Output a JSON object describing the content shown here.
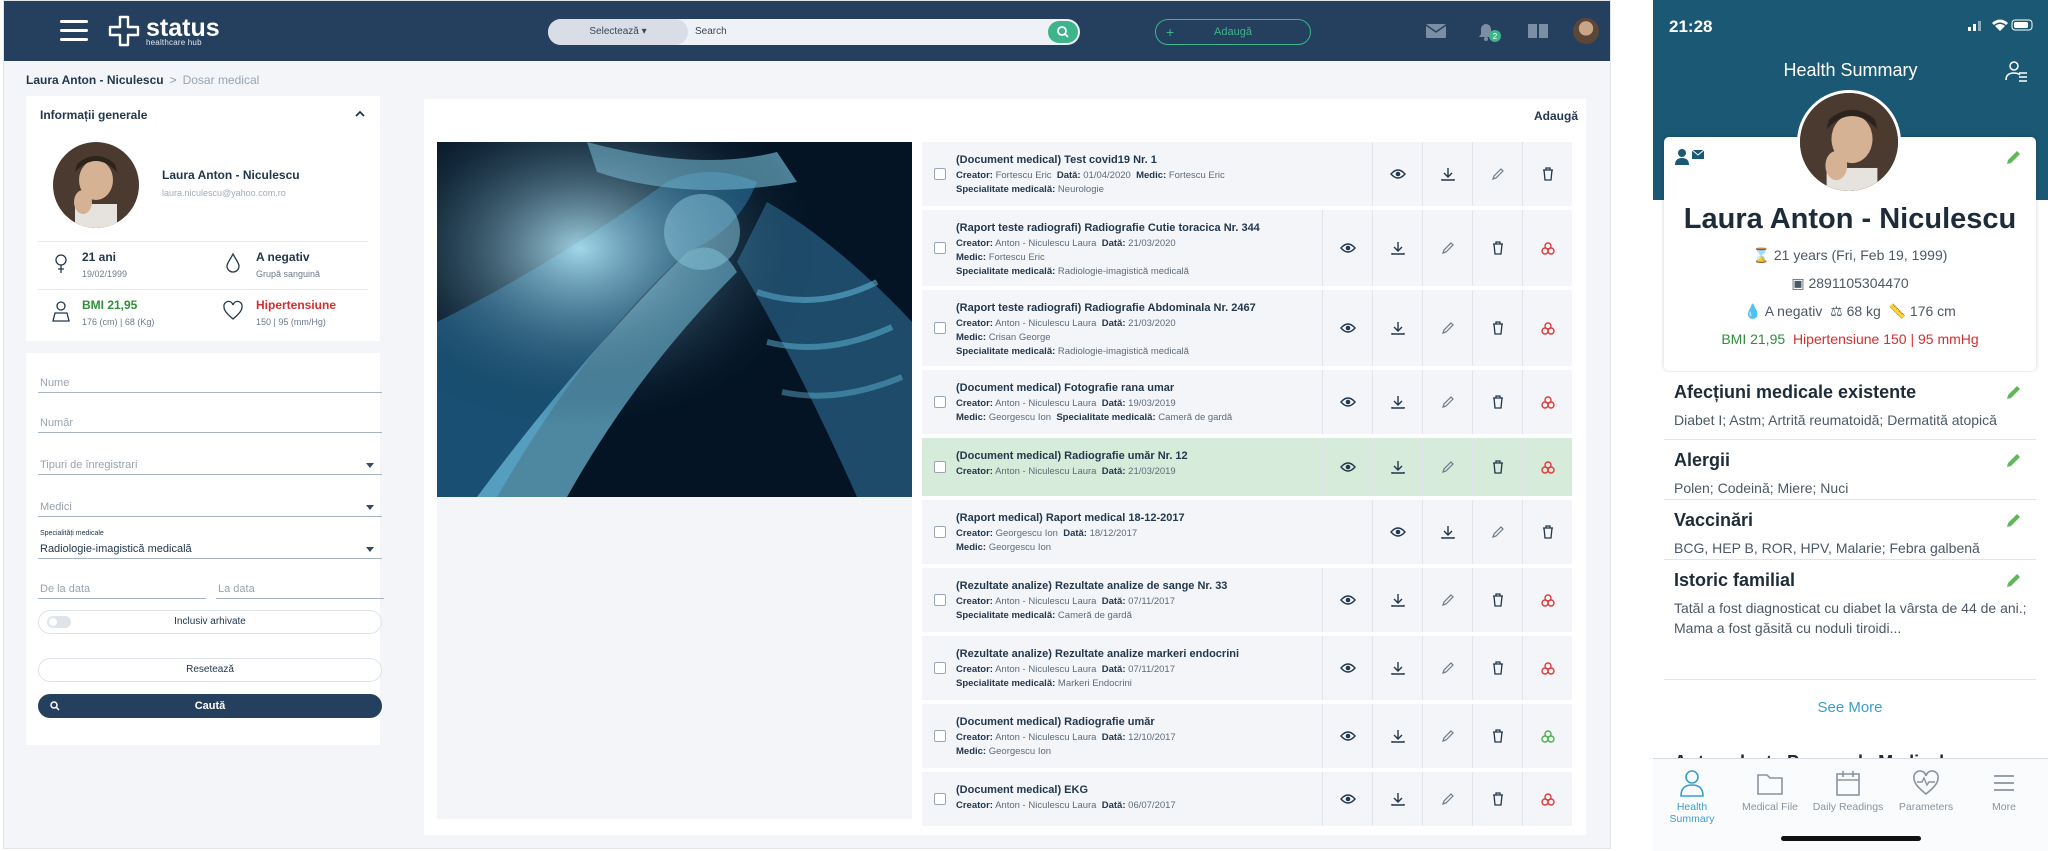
{
  "desktop": {
    "brand": {
      "name": "status",
      "tagline": "healthcare hub"
    },
    "search": {
      "select_label": "Selectează ▾",
      "placeholder": "Search"
    },
    "add_top": "Adaugă",
    "notif_count": "2",
    "breadcrumb": {
      "patient": "Laura Anton - Niculescu",
      "separator": ">",
      "current": "Dosar medical"
    },
    "info": {
      "title": "Informații generale",
      "name": "Laura Anton - Niculescu",
      "email": "laura.niculescu@yahoo.com.ro",
      "age": "21 ani",
      "birth": "19/02/1999",
      "blood": "A negativ",
      "blood_label": "Grupă sanguină",
      "bmi": "BMI 21,95",
      "bmi_sub": "176 (cm) | 68 (Kg)",
      "bp": "Hipertensiune",
      "bp_sub": "150 | 95 (mm/Hg)",
      "bmi_color": "#2f8f3a",
      "bp_color": "#d32f2f"
    },
    "filters": {
      "name_ph": "Nume",
      "number_ph": "Număr",
      "type_ph": "Tipuri de înregistrari",
      "doctors_ph": "Medici",
      "spec_label": "Specialități medicale",
      "spec_value": "Radiologie-imagistică medicală",
      "from_ph": "De la data",
      "to_ph": "La data",
      "archived": "Inclusiv arhivate",
      "reset": "Resetează",
      "search": "Caută"
    },
    "add_label": "Adaugă",
    "labels": {
      "creator": "Creator:",
      "date": "Dată:",
      "doctor": "Medic:",
      "specialty": "Specialitate medicală:"
    },
    "documents": [
      {
        "title": "(Document medical) Test covid19 Nr. 1",
        "creator": "Fortescu Eric",
        "date": "01/04/2020",
        "doctor": "Fortescu Eric",
        "specialty": "Neurologie"
      },
      {
        "title": "(Raport teste radiografi) Radiografie Cutie toracica Nr. 344",
        "creator": "Anton - Niculescu Laura",
        "date": "21/03/2020",
        "doctor": "Fortescu Eric",
        "specialty": "Radiologie-imagistică medicală"
      },
      {
        "title": "(Raport teste radiografi) Radiografie Abdominala Nr. 2467",
        "creator": "Anton - Niculescu Laura",
        "date": "21/03/2020",
        "doctor": "Crisan George",
        "specialty": "Radiologie-imagistică medicală"
      },
      {
        "title": "(Document medical) Fotografie rana umar",
        "creator": "Anton - Niculescu Laura",
        "date": "19/03/2019",
        "doctor": "Georgescu Ion",
        "specialty": "Cameră de gardă"
      },
      {
        "title": "(Document medical) Radiografie umăr Nr. 12",
        "creator": "Anton - Niculescu Laura",
        "date": "21/03/2019"
      },
      {
        "title": "(Raport medical) Raport medical 18-12-2017",
        "creator": "Georgescu Ion",
        "date": "18/12/2017",
        "doctor": "Georgescu Ion"
      },
      {
        "title": "(Rezultate analize) Rezultate analize de sange Nr. 33",
        "creator": "Anton - Niculescu Laura",
        "date": "07/11/2017",
        "specialty": "Cameră de gardă"
      },
      {
        "title": "(Rezultate analize) Rezultate analize markeri endocrini",
        "creator": "Anton - Niculescu Laura",
        "date": "07/11/2017",
        "specialty": "Markeri Endocrini"
      },
      {
        "title": "(Document medical) Radiografie umăr",
        "creator": "Anton - Niculescu Laura",
        "date": "12/10/2017",
        "doctor": "Georgescu Ion"
      },
      {
        "title": "(Document medical) EKG",
        "creator": "Anton - Niculescu Laura",
        "date": "06/07/2017"
      }
    ]
  },
  "mobile": {
    "time": "21:28",
    "title": "Health Summary",
    "name": "Laura Anton - Niculescu",
    "age_line": "21 years (Fri, Feb 19, 1999)",
    "id_number": "2891105304470",
    "blood": "A negativ",
    "weight": "68 kg",
    "height": "176 cm",
    "bmi": "BMI 21,95",
    "bp": "Hipertensiune 150 | 95 mmHg",
    "sections": [
      {
        "title": "Afecțiuni medicale existente",
        "text": "Diabet I; Astm; Artrită reumatoidă; Dermatită atopică"
      },
      {
        "title": "Alergii",
        "text": "Polen; Codeină; Miere; Nuci"
      },
      {
        "title": "Vaccinări",
        "text": "BCG, HEP B, ROR, HPV, Malarie; Febra galbenă"
      },
      {
        "title": "Istoric familial",
        "text": "Tatăl a fost diagnosticat cu diabet la vârsta de 44 de ani.; Mama a fost găsită cu noduli tiroidi..."
      }
    ],
    "see_more": "See More",
    "cut_title": "Antecedente Personale Medicale",
    "tabs": [
      "Health Summary",
      "Medical File",
      "Daily Readings",
      "Parameters",
      "More"
    ],
    "accent": "#3a9ecb",
    "header_color": "#1b5874"
  }
}
